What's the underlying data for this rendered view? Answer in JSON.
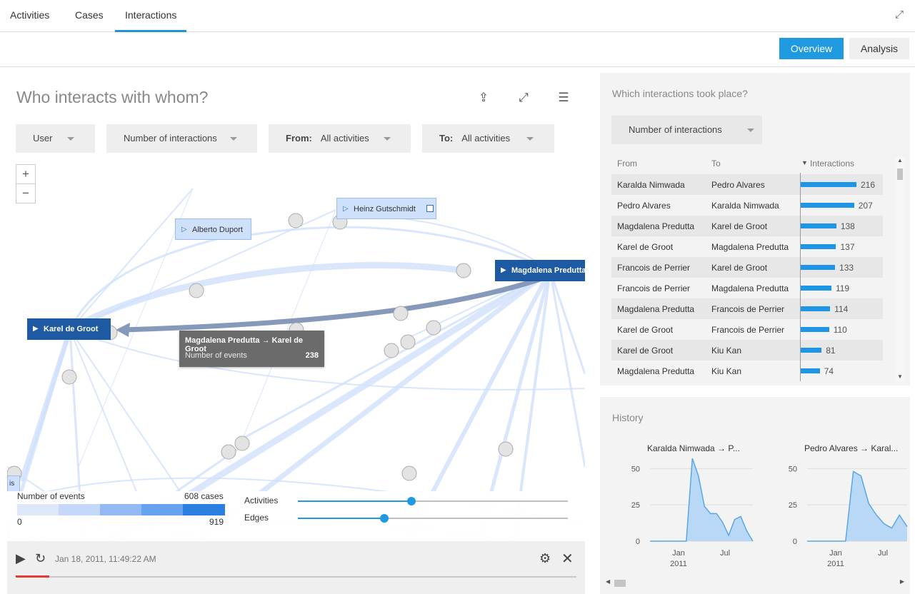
{
  "tabs": [
    "Activities",
    "Cases",
    "Interactions"
  ],
  "header": {
    "overview_label": "Overview",
    "analysis_label": "Analysis"
  },
  "main": {
    "title": "Who interacts with whom?",
    "dropdowns": {
      "user": "User",
      "metric": "Number of interactions",
      "from_label": "From:",
      "from_value": "All activities",
      "to_label": "To:",
      "to_value": "All activities"
    },
    "zoom": {
      "in": "+",
      "out": "−"
    },
    "nodes": {
      "heinz": "Heinz Gutschmidt",
      "alberto": "Alberto Duport",
      "magdalena": "Magdalena Predutta",
      "karel": "Karel de Groot",
      "partial": "is"
    },
    "tooltip": {
      "title": "Magdalena Predutta → Karel de Groot",
      "metric": "Number of events",
      "value": "238"
    },
    "legend": {
      "label": "Number of events",
      "cases": "608 cases",
      "min": "0",
      "max": "919",
      "colors": [
        "#dde8fb",
        "#c6d8fa",
        "#93b9f4",
        "#67a2ef",
        "#2a7fe0"
      ]
    },
    "sliders": {
      "activities_label": "Activities",
      "activities_value": 0.42,
      "edges_label": "Edges",
      "edges_value": 0.32
    },
    "player": {
      "timestamp": "Jan 18, 2011, 11:49:22 AM",
      "progress": 0.06
    }
  },
  "interactions_panel": {
    "title": "Which interactions took place?",
    "dropdown": "Number of interactions",
    "columns": {
      "from": "From",
      "to": "To",
      "interactions": "Interactions",
      "sort_icon": "▼"
    },
    "rows": [
      {
        "from": "Karalda Nimwada",
        "to": "Pedro Alvares",
        "value": 216
      },
      {
        "from": "Pedro Alvares",
        "to": "Karalda Nimwada",
        "value": 207
      },
      {
        "from": "Magdalena Predutta",
        "to": "Karel de Groot",
        "value": 138
      },
      {
        "from": "Karel de Groot",
        "to": "Magdalena Predutta",
        "value": 137
      },
      {
        "from": "Francois de Perrier",
        "to": "Karel de Groot",
        "value": 133
      },
      {
        "from": "Francois de Perrier",
        "to": "Magdalena Predutta",
        "value": 119
      },
      {
        "from": "Magdalena Predutta",
        "to": "Francois de Perrier",
        "value": 114
      },
      {
        "from": "Karel de Groot",
        "to": "Francois de Perrier",
        "value": 110
      },
      {
        "from": "Karel de Groot",
        "to": "Kiu Kan",
        "value": 81
      },
      {
        "from": "Magdalena Predutta",
        "to": "Kiu Kan",
        "value": 74
      }
    ]
  },
  "history_panel": {
    "title": "History",
    "chart_data": [
      {
        "type": "area",
        "title": "Karalda Nimwada → P...",
        "x": [
          0,
          1,
          2,
          3,
          4,
          5,
          6,
          7,
          8,
          9,
          10,
          11,
          12,
          13,
          14,
          15,
          16,
          17
        ],
        "values": [
          0,
          0,
          0,
          0,
          0,
          0,
          0,
          57,
          45,
          24,
          19,
          19,
          13,
          4,
          15,
          17,
          7,
          0
        ],
        "ylim": [
          0,
          60
        ],
        "yticks": [
          "50",
          "25",
          "0"
        ],
        "xticks": [
          "Jan\n2011",
          "Jul"
        ],
        "color": "#5aa7e8"
      },
      {
        "type": "area",
        "title": "Pedro Alvares → Karal...",
        "x": [
          0,
          1,
          2,
          3,
          4,
          5,
          6,
          7,
          8,
          9,
          10,
          11,
          12,
          13
        ],
        "values": [
          0,
          0,
          0,
          0,
          0,
          0,
          48,
          45,
          26,
          18,
          12,
          9,
          18,
          10
        ],
        "ylim": [
          0,
          60
        ],
        "yticks": [
          "50",
          "25",
          "0"
        ],
        "xticks": [
          "Jan\n2011",
          "Jul"
        ],
        "color": "#5aa7e8"
      }
    ]
  }
}
